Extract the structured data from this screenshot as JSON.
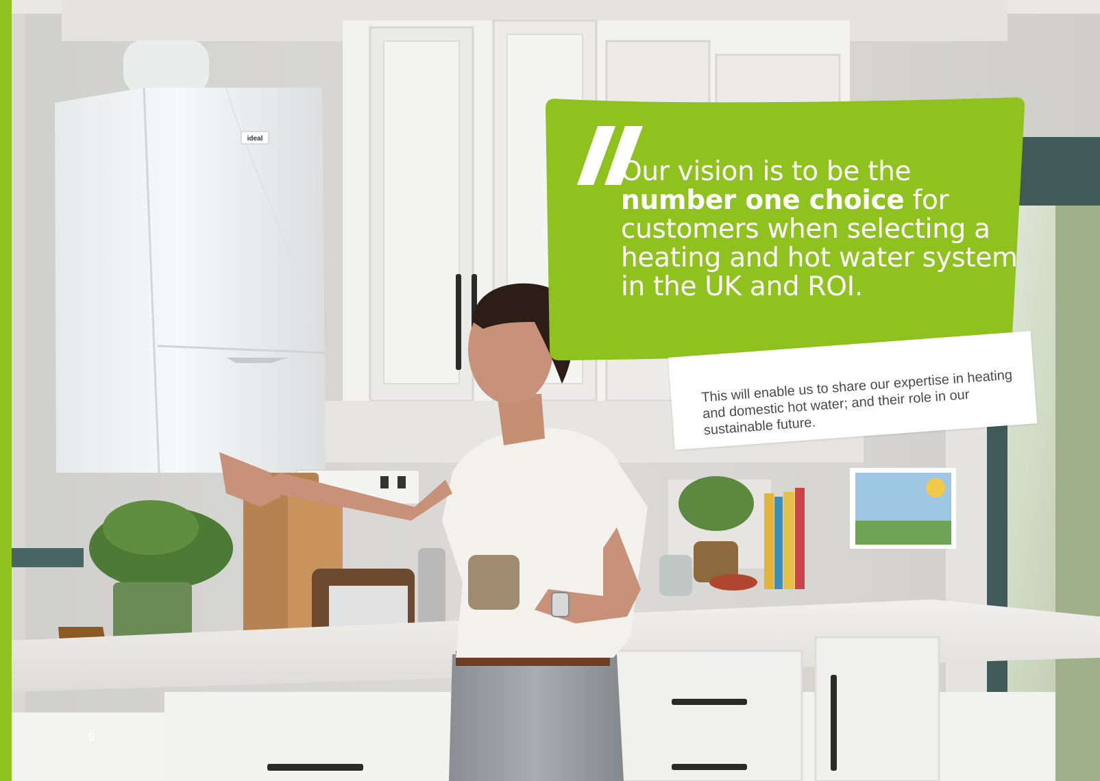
{
  "page_number": "9",
  "quote": {
    "part1": "Our vision is to be the",
    "part_bold": "number one choice",
    "part2": "for customers when selecting a heating and hot water system in the UK and ROI."
  },
  "caption": "This will enable us to share our expertise in heating and domestic hot water; and their role in our sustainable future.",
  "boiler_logo": "ideal",
  "colors": {
    "accent_green": "#8fc21e",
    "white": "#ffffff",
    "caption_text": "#4a4a4a"
  }
}
